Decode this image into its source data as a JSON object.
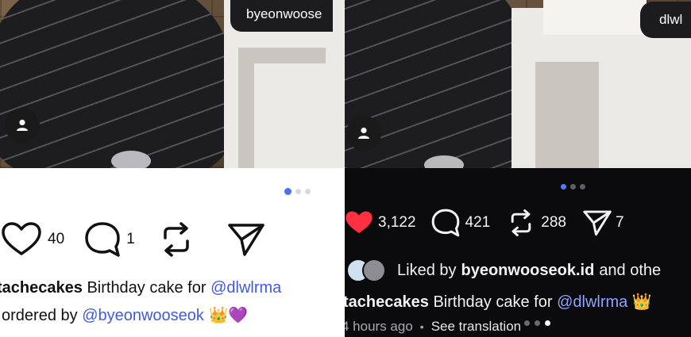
{
  "left": {
    "tag": "byeonwoose",
    "likes": "40",
    "comments": "1",
    "caption": {
      "username": "tachecakes",
      "text": "Birthday cake for",
      "mention": "@dlwlrma",
      "line2_prefix": "ordered by",
      "line2_mention": "@byeonwooseok",
      "emoji": "👑💜"
    },
    "colors": {
      "background": "#ffffff",
      "text": "#111111",
      "mention": "#3f5ae0",
      "dot_active": "#4f6ef0"
    }
  },
  "right": {
    "tag": "dlwl",
    "likes": "3,122",
    "comments": "421",
    "reposts": "288",
    "shares": "7",
    "liked_by": {
      "prefix": "Liked by",
      "user": "byeonwooseok.id",
      "suffix": "and othe"
    },
    "caption": {
      "username": "tachecakes",
      "text": "Birthday cake for",
      "mention": "@dlwlrma",
      "emoji": "👑"
    },
    "time": "4 hours ago",
    "separator": "•",
    "translate": "See translation",
    "colors": {
      "background": "#0b0b0e",
      "text": "#f2f2f2",
      "heart": "#ff3040",
      "mention": "#8fa4ff",
      "dot_active": "#5a78ff"
    }
  }
}
